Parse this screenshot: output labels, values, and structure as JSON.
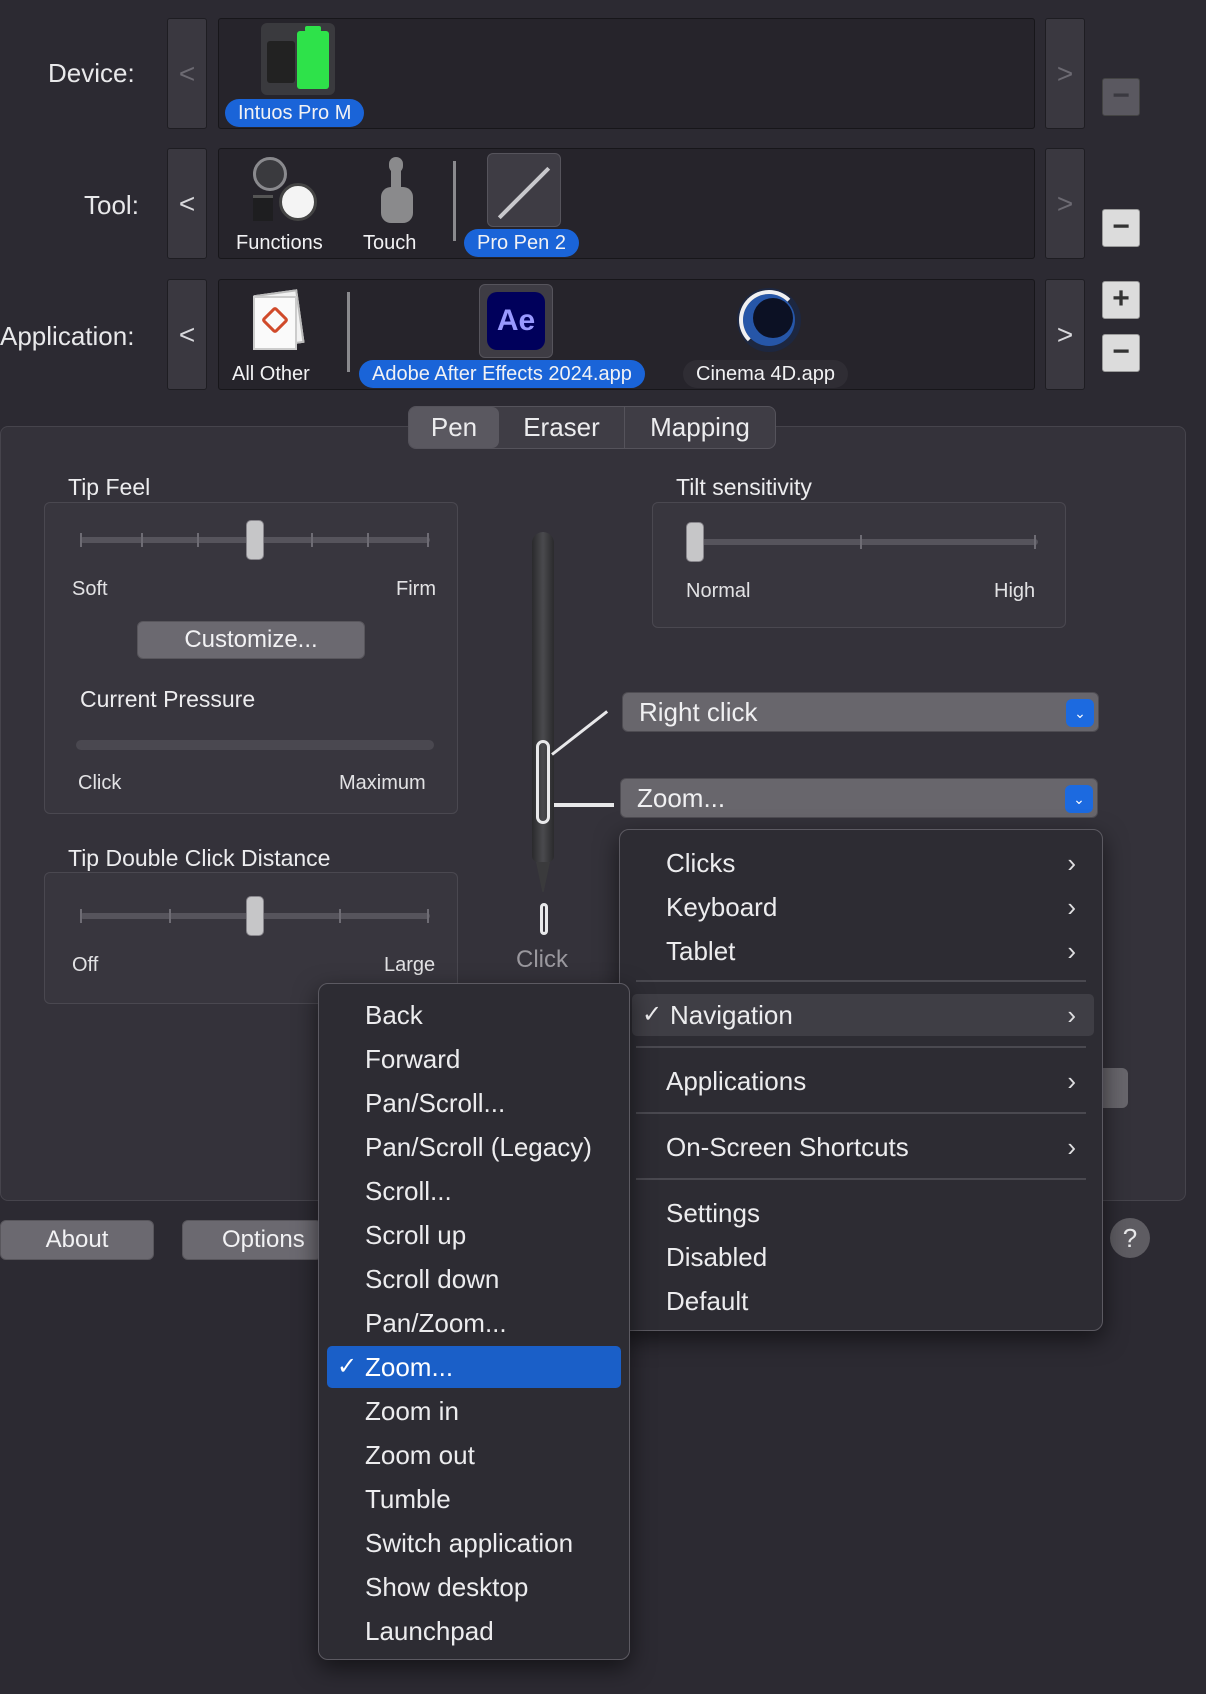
{
  "rows": {
    "device_label": "Device:",
    "tool_label": "Tool:",
    "application_label": "Application:"
  },
  "nav": {
    "prev": "<",
    "next": ">"
  },
  "device": {
    "items": [
      {
        "label": "Intuos Pro M",
        "icon": "tablet-battery-icon",
        "selected": true
      }
    ]
  },
  "tools": {
    "items": [
      {
        "label": "Functions",
        "icon": "functions-icon",
        "selected": false
      },
      {
        "label": "Touch",
        "icon": "touch-hand-icon",
        "selected": false
      },
      {
        "label": "Pro Pen 2",
        "icon": "pen-icon",
        "selected": true
      }
    ]
  },
  "applications": {
    "items": [
      {
        "label": "All Other",
        "icon": "all-other-apps-icon",
        "selected": false
      },
      {
        "label": "Adobe After Effects 2024.app",
        "icon": "after-effects-icon",
        "icon_text": "Ae",
        "selected": true
      },
      {
        "label": "Cinema 4D.app",
        "icon": "cinema4d-icon",
        "selected": false
      }
    ]
  },
  "side_buttons": {
    "plus": "+",
    "minus": "−"
  },
  "tabs": [
    {
      "label": "Pen",
      "active": true
    },
    {
      "label": "Eraser",
      "active": false
    },
    {
      "label": "Mapping",
      "active": false
    }
  ],
  "tip_feel": {
    "title": "Tip Feel",
    "min_label": "Soft",
    "max_label": "Firm",
    "position_fraction": 0.5,
    "customize_label": "Customize...",
    "pressure_title": "Current Pressure",
    "pressure_min": "Click",
    "pressure_max": "Maximum"
  },
  "tip_double_click": {
    "title": "Tip Double Click Distance",
    "min_label": "Off",
    "max_label": "Large",
    "position_fraction": 0.5
  },
  "tilt": {
    "title": "Tilt sensitivity",
    "min_label": "Normal",
    "max_label": "High",
    "position_fraction": 0.0
  },
  "pen_buttons": {
    "upper": "Right click",
    "lower": "Zoom...",
    "tip": "Click"
  },
  "footer": {
    "about": "About",
    "options": "Options",
    "help": "?"
  },
  "category_menu": {
    "items": [
      {
        "label": "Clicks",
        "submenu": true,
        "checked": false
      },
      {
        "label": "Keyboard",
        "submenu": true,
        "checked": false
      },
      {
        "label": "Tablet",
        "submenu": true,
        "checked": false
      },
      {
        "label": "Navigation",
        "submenu": true,
        "checked": true
      },
      {
        "label": "Applications",
        "submenu": true,
        "checked": false
      },
      {
        "label": "On-Screen Shortcuts",
        "submenu": true,
        "checked": false
      },
      {
        "label": "Settings",
        "submenu": false,
        "checked": false
      },
      {
        "label": "Disabled",
        "submenu": false,
        "checked": false
      },
      {
        "label": "Default",
        "submenu": false,
        "checked": false
      }
    ]
  },
  "navigation_submenu": {
    "items": [
      {
        "label": "Back",
        "checked": false
      },
      {
        "label": "Forward",
        "checked": false
      },
      {
        "label": "Pan/Scroll...",
        "checked": false
      },
      {
        "label": "Pan/Scroll (Legacy)",
        "checked": false
      },
      {
        "label": "Scroll...",
        "checked": false
      },
      {
        "label": "Scroll up",
        "checked": false
      },
      {
        "label": "Scroll down",
        "checked": false
      },
      {
        "label": "Pan/Zoom...",
        "checked": false
      },
      {
        "label": "Zoom...",
        "checked": true
      },
      {
        "label": "Zoom in",
        "checked": false
      },
      {
        "label": "Zoom out",
        "checked": false
      },
      {
        "label": "Tumble",
        "checked": false
      },
      {
        "label": "Switch application",
        "checked": false
      },
      {
        "label": "Show desktop",
        "checked": false
      },
      {
        "label": "Launchpad",
        "checked": false
      }
    ]
  },
  "marks": {
    "check": "✓",
    "chevron": "›",
    "dropdown_arrow": "⌄"
  },
  "colors": {
    "accent": "#1a64d8",
    "background": "#2c2a32",
    "battery": "#2ee24a"
  }
}
